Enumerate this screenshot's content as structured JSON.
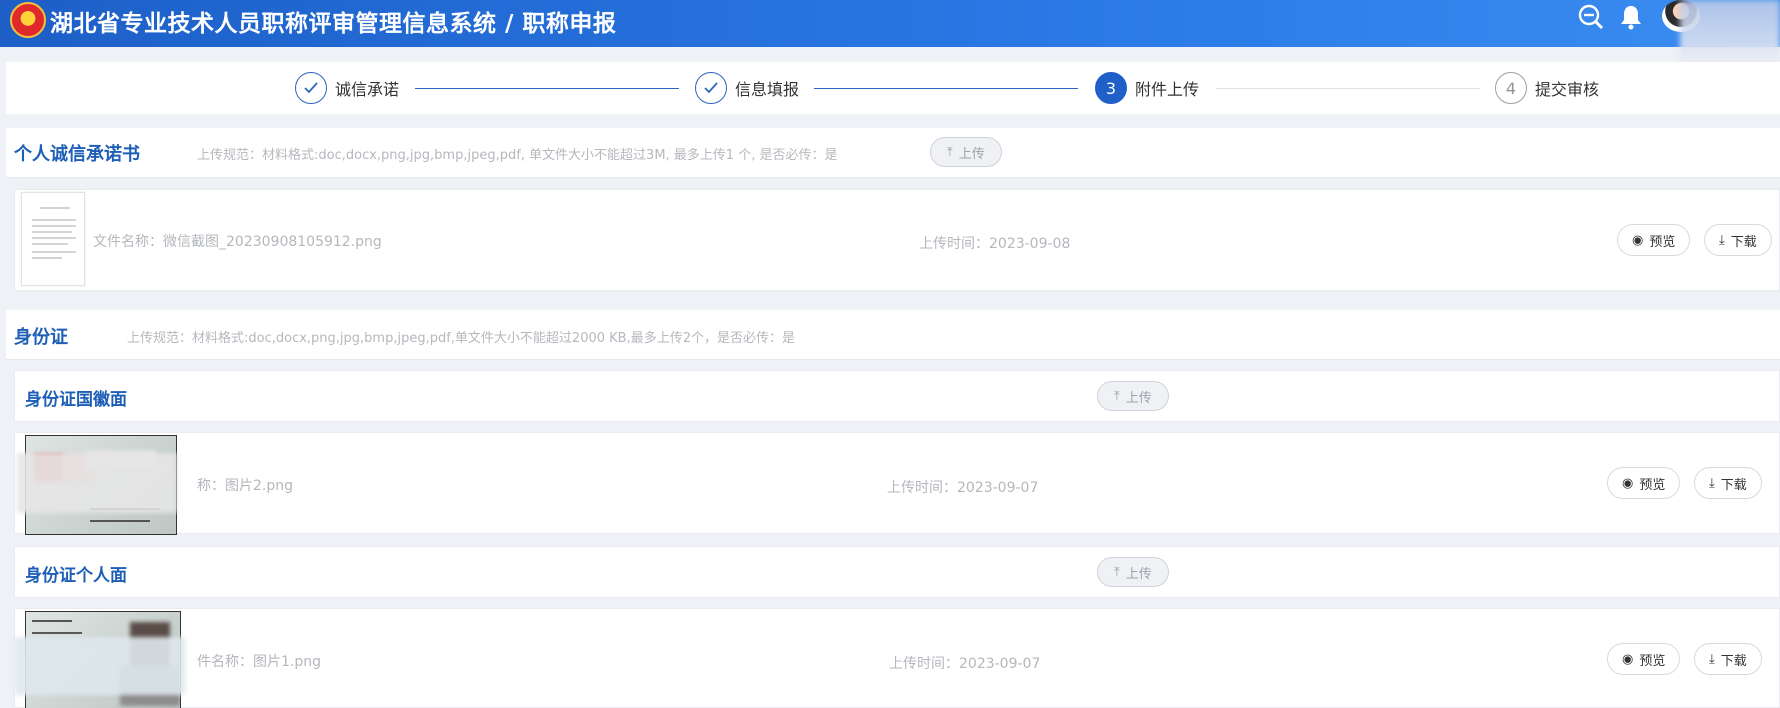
{
  "header": {
    "title": "湖北省专业技术人员职称评审管理信息系统 / 职称申报",
    "icons": [
      "zoom-out-icon",
      "bell-icon",
      "avatar"
    ]
  },
  "steps": [
    {
      "number": "1",
      "label": "诚信承诺",
      "status": "done"
    },
    {
      "number": "2",
      "label": "信息填报",
      "status": "done"
    },
    {
      "number": "3",
      "label": "附件上传",
      "status": "active"
    },
    {
      "number": "4",
      "label": "提交审核",
      "status": "pending"
    }
  ],
  "colors": {
    "primary": "#1f5fc8",
    "title": "#1d5fb6",
    "muted": "#b4b7bc"
  },
  "sections": {
    "integrity": {
      "title": "个人诚信承诺书",
      "rule": "上传规范：材料格式:doc,docx,png,jpg,bmp,jpeg,pdf, 单文件大小不能超过3M, 最多上传1 个, 是否必传：是",
      "upload_label": "上传",
      "file": {
        "name": "文件名称：微信截图_20230908105912.png",
        "time": "上传时间：2023-09-08"
      }
    },
    "idcard": {
      "title": "身份证",
      "rule": "上传规范：材料格式:doc,docx,png,jpg,bmp,jpeg,pdf,单文件大小不能超过2000 KB,最多上传2个，是否必传：是",
      "front": {
        "title": "身份证国徽面",
        "upload_label": "上传",
        "file": {
          "name": "称：图片2.png",
          "time": "上传时间：2023-09-07"
        }
      },
      "back": {
        "title": "身份证个人面",
        "upload_label": "上传",
        "file": {
          "name": "件名称：图片1.png",
          "time": "上传时间：2023-09-07"
        }
      }
    }
  },
  "actions": {
    "preview": "预览",
    "download": "下载"
  }
}
